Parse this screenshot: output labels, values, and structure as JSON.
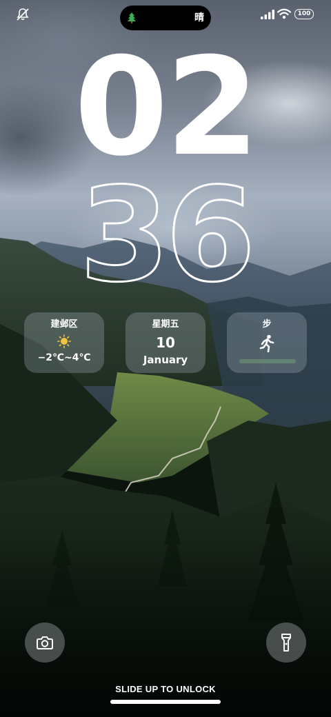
{
  "status_bar": {
    "island_weather": "晴",
    "battery_level": "100",
    "icons": [
      "mute-icon",
      "tree-icon",
      "signal-icon",
      "wifi-icon",
      "battery-icon"
    ]
  },
  "clock": {
    "hour": "02",
    "minute": "36"
  },
  "widgets": {
    "weather": {
      "location": "建邺区",
      "icon": "sun-icon",
      "temperature": "−2℃~4℃"
    },
    "date": {
      "weekday": "星期五",
      "day": "10",
      "month": "January"
    },
    "steps": {
      "title": "步",
      "icon": "running-icon",
      "progress": 0.0
    }
  },
  "bottom": {
    "camera_icon": "camera-icon",
    "flashlight_icon": "flashlight-icon",
    "unlock_hint": "SLIDE UP TO UNLOCK"
  },
  "colors": {
    "widget_bg": "#b4bec8",
    "steps_bar": "#7cc47c"
  }
}
